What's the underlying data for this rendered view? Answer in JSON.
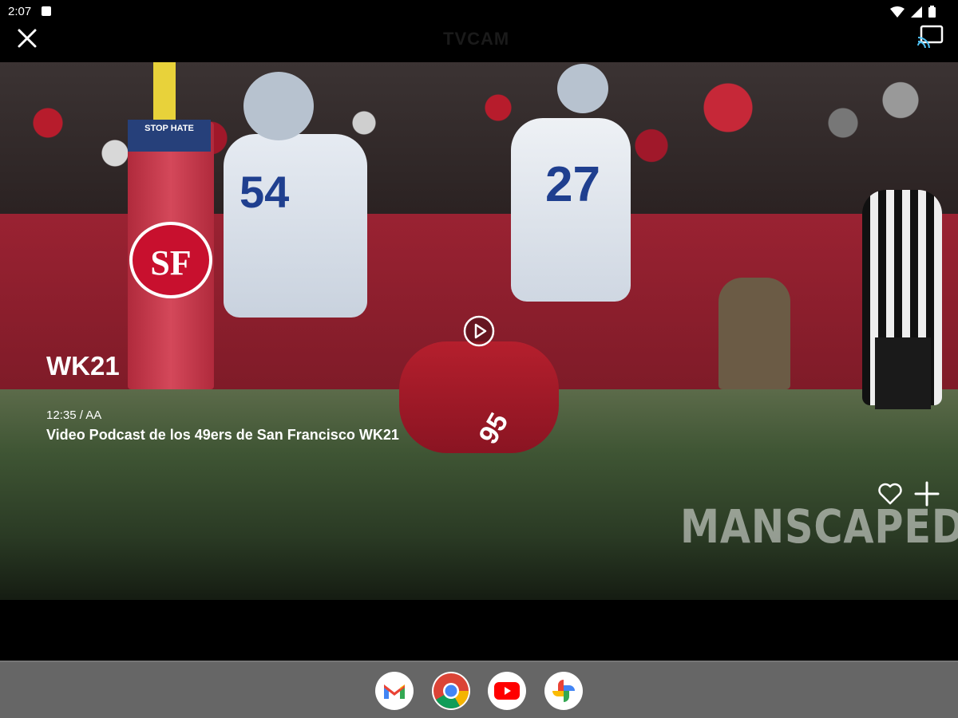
{
  "status_bar": {
    "time": "2:07"
  },
  "header": {
    "brand_logo": "TVCAM"
  },
  "player": {
    "episode_tag": "WK21",
    "meta": "12:35 / AA",
    "title": "Video Podcast de los 49ers de San Francisco WK21",
    "sponsor_watermark": "MANSCAPED",
    "scene_text": {
      "pad_sign": "STOP HATE",
      "pad_logo": "SF",
      "jersey_left": "54",
      "jersey_center": "27",
      "jersey_down": "95"
    }
  },
  "dock": {
    "apps": [
      "gmail-icon",
      "chrome-icon",
      "youtube-icon",
      "photos-icon"
    ]
  },
  "colors": {
    "niners_red": "#b71c2c",
    "cowboys_blue": "#1f3f8f",
    "dock_bg": "#666666"
  }
}
